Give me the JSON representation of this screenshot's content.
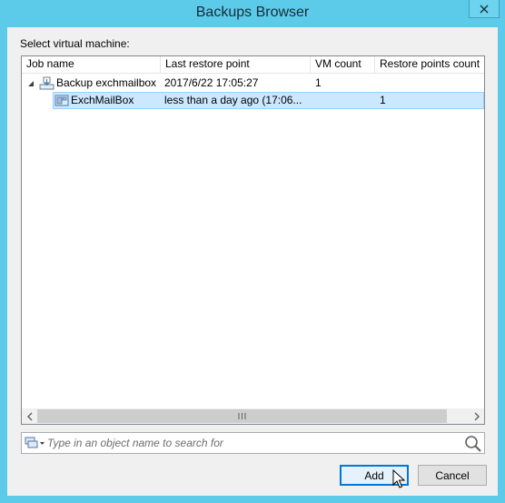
{
  "window": {
    "title": "Backups Browser"
  },
  "dialog": {
    "prompt": "Select virtual machine:",
    "columns": [
      "Job name",
      "Last restore point",
      "VM count",
      "Restore points count"
    ],
    "rows": [
      {
        "name": "Backup exchmailbox",
        "last_restore_point": "2017/6/22 17:05:27",
        "vm_count": "1",
        "restore_points_count": "",
        "expanded": true,
        "selected": false
      },
      {
        "name": "ExchMailBox",
        "last_restore_point": "less than a day ago (17:06...",
        "vm_count": "",
        "restore_points_count": "1",
        "expanded": false,
        "selected": true
      }
    ],
    "search": {
      "placeholder": "Type in an object name to search for",
      "value": ""
    },
    "buttons": {
      "add": "Add",
      "cancel": "Cancel"
    }
  },
  "icons": {
    "close": "close-icon",
    "expand": "expand-triangle-icon",
    "backup_job": "backup-job-icon",
    "vm": "vm-icon",
    "object_type": "object-type-dropdown-icon",
    "search": "search-icon",
    "cursor": "mouse-pointer-icon"
  },
  "colors": {
    "title_bar": "#5ccbea",
    "selection": "#cce8ff",
    "default_button": "#e5f1fb"
  }
}
